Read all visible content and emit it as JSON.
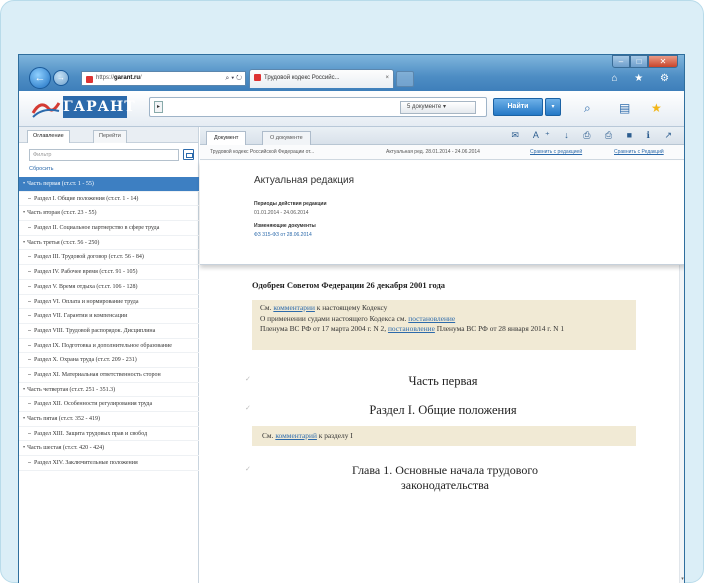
{
  "browser": {
    "address": "https://",
    "address_bold": "garant.ru",
    "address_tail": "/",
    "address_ctrls": "⌕ ▾ ↻",
    "tab_title": "Трудовой кодекс Российс...",
    "tab_close": "×",
    "toolbar_icons": "⌂ ★ ⚙",
    "win_min": "–",
    "win_max": "□",
    "win_close": "✕"
  },
  "app": {
    "logo": "ГАРАНТ",
    "search_value": "",
    "search_scope": "5 документе",
    "find_label": "Найти",
    "find_arrow": "▾",
    "icon_search": "⌕",
    "icon_docs": "▤",
    "icon_star": "★"
  },
  "left": {
    "tab_contents": "Оглавление",
    "tab_bookmarks": "Перейти",
    "search_placeholder": "Фильтр",
    "reset": "Сбросить",
    "items": [
      {
        "text": "Часть первая (ст.ст. 1 - 55)",
        "level": 1,
        "selected": true
      },
      {
        "text": "Раздел I. Общие положения (ст.ст. 1 - 14)",
        "level": 2
      },
      {
        "text": "Часть вторая (ст.ст. 23 - 55)",
        "level": 1
      },
      {
        "text": "Раздел II. Социальное партнерство в сфере труда",
        "level": 2
      },
      {
        "text": "Часть третья (ст.ст. 56 - 250)",
        "level": 1
      },
      {
        "text": "Раздел III. Трудовой договор (ст.ст. 56 - 84)",
        "level": 2
      },
      {
        "text": "Раздел IV. Рабочее время (ст.ст. 91 - 105)",
        "level": 2
      },
      {
        "text": "Раздел V. Время отдыха (ст.ст. 106 - 128)",
        "level": 2
      },
      {
        "text": "Раздел VI. Оплата и нормирование труда",
        "level": 2
      },
      {
        "text": "Раздел VII. Гарантии и компенсации",
        "level": 2
      },
      {
        "text": "Раздел VIII. Трудовой распорядок. Дисциплина",
        "level": 2
      },
      {
        "text": "Раздел IX. Подготовка и дополнительное образование",
        "level": 2
      },
      {
        "text": "Раздел X. Охрана труда (ст.ст. 209 - 231)",
        "level": 2
      },
      {
        "text": "Раздел XI. Материальная ответственность сторон",
        "level": 2
      },
      {
        "text": "Часть четвертая (ст.ст. 251 - 351.3)",
        "level": 1
      },
      {
        "text": "Раздел XII. Особенности регулирования труда",
        "level": 2
      },
      {
        "text": "Часть пятая (ст.ст. 352 - 419)",
        "level": 1
      },
      {
        "text": "Раздел XIII. Защита трудовых прав и свобод",
        "level": 2
      },
      {
        "text": "Часть шестая (ст.ст. 420 - 424)",
        "level": 1
      },
      {
        "text": "Раздел XIV. Заключительные положения",
        "level": 2
      }
    ]
  },
  "doc": {
    "tab_document": "Документ",
    "tab_about": "О документе",
    "tools": "✉ A⁺ ↓ ⎙ ⎙ ■ ℹ ↗",
    "info_title": "Трудовой кодекс Российской Федерации от...",
    "info_redaction": "Актуальная ред. 28.01.2014 - 24.06.2014",
    "info_compare": "Сравнить с редакцией",
    "info_compare2": "Сравнить с Редакций",
    "redaction_title": "Актуальная редакция",
    "period_label": "Периоды действия редакции",
    "period_value": "01.01.2014 - 24.06.2014",
    "base_label": "Изменяющие документы",
    "base_value": "ФЗ 315-ФЗ от 28.06.2014",
    "approved": "Одобрен Советом Федерации 26 декабря 2001 года",
    "note1_a": "См.",
    "note1_link1": "комментарии",
    "note1_b": "к настоящему Кодексу",
    "note1_c": "О применении судами настоящего Кодекса см.",
    "note1_link2": "постановление",
    "note1_d": "Пленума ВС РФ от 17 марта 2004 г. N 2,",
    "note1_link3": "постановление",
    "note1_e": "Пленума ВС РФ от 28 января 2014 г. N 1",
    "part1": "Часть первая",
    "section1": "Раздел I. Общие положения",
    "note2_a": "См.",
    "note2_link": "комментарий",
    "note2_b": "к разделу I",
    "chapter1_line1": "Глава 1. Основные начала трудового",
    "chapter1_line2": "законодательства",
    "tick": "✓",
    "scroll_down": "▾"
  }
}
